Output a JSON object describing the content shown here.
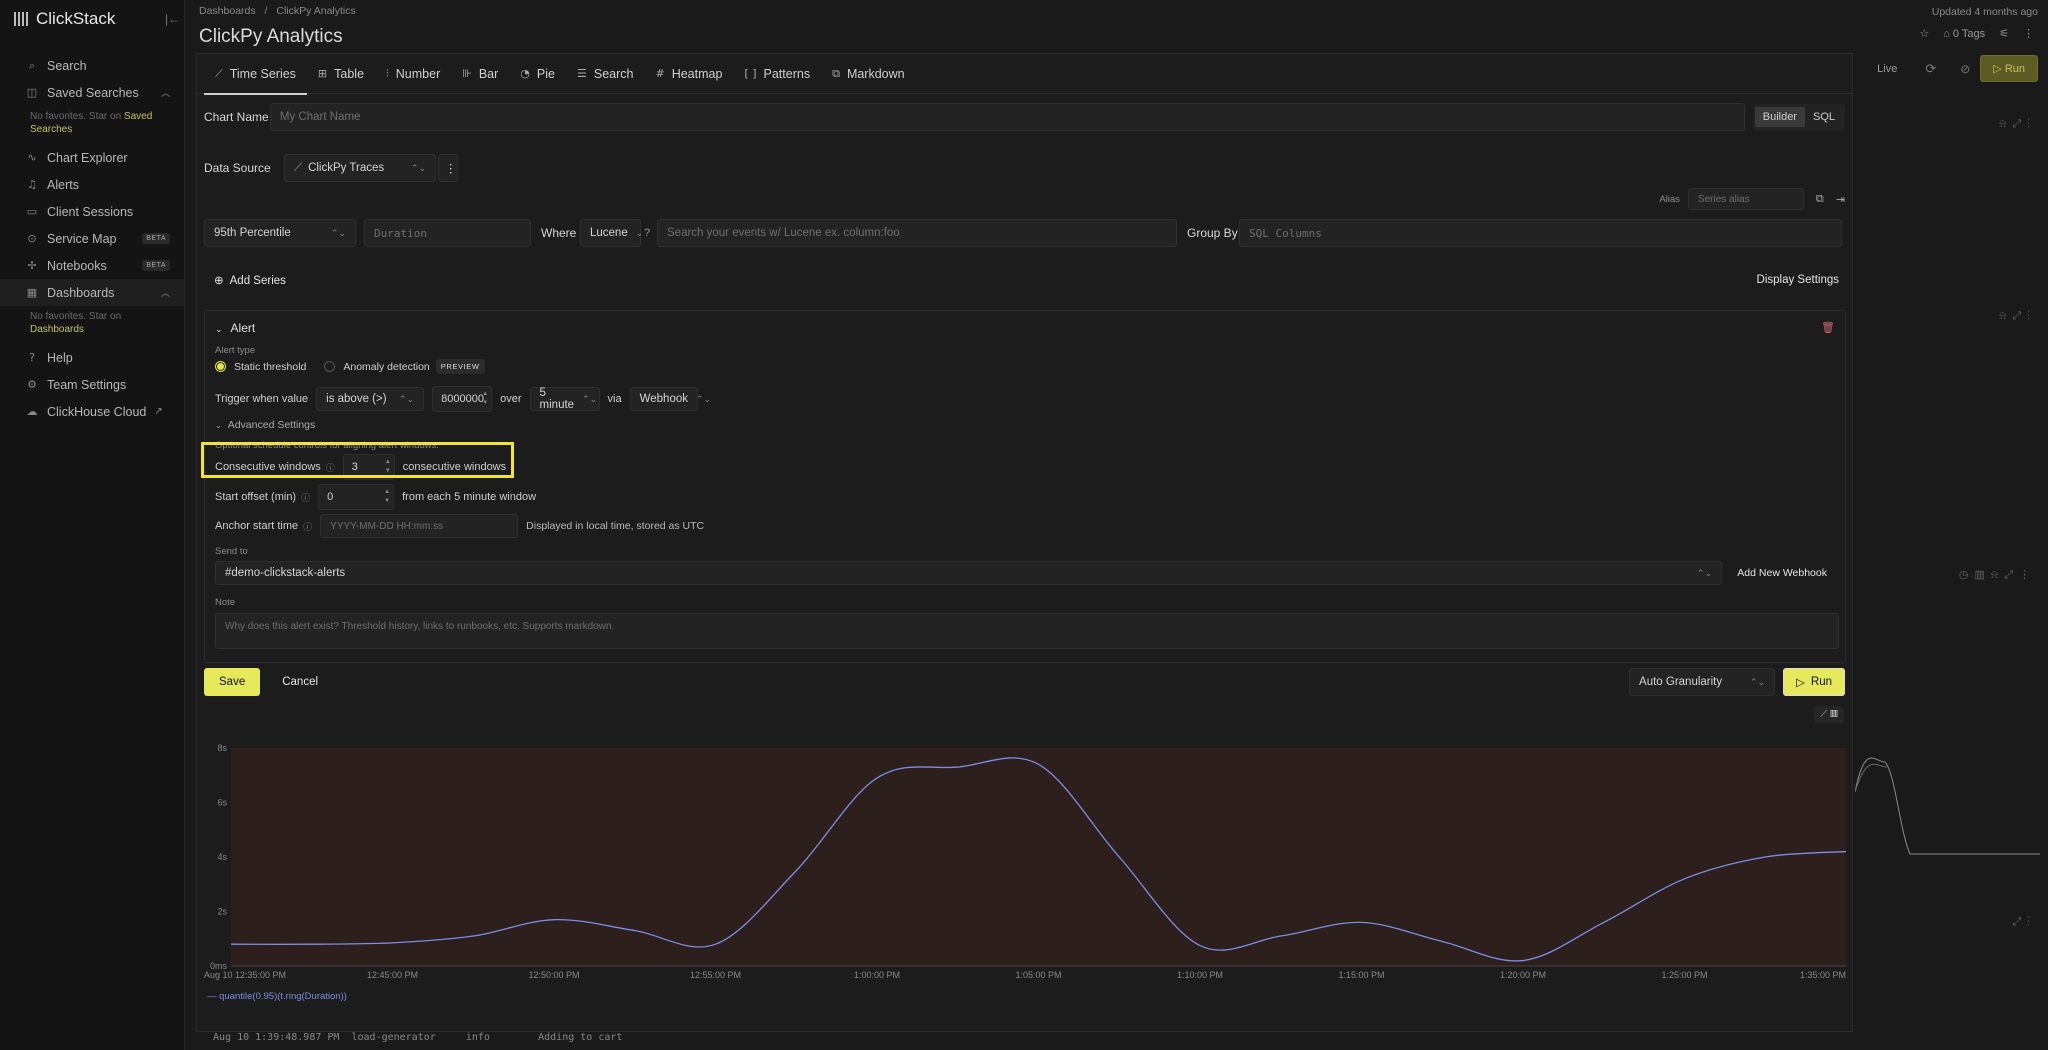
{
  "app": {
    "brand": "ClickStack"
  },
  "sidebar": {
    "items": [
      {
        "label": "Search",
        "icon": "search-icon"
      },
      {
        "label": "Saved Searches",
        "icon": "bookmark-icon"
      },
      {
        "label": "Chart Explorer",
        "icon": "chart-icon"
      },
      {
        "label": "Alerts",
        "icon": "bell-icon"
      },
      {
        "label": "Client Sessions",
        "icon": "browser-icon"
      },
      {
        "label": "Service Map",
        "icon": "map-icon",
        "badge": "BETA"
      },
      {
        "label": "Notebooks",
        "icon": "notebook-icon",
        "badge": "BETA"
      },
      {
        "label": "Dashboards",
        "icon": "dashboard-icon"
      },
      {
        "label": "Help",
        "icon": "help-icon"
      },
      {
        "label": "Team Settings",
        "icon": "gear-icon"
      },
      {
        "label": "ClickHouse Cloud",
        "icon": "cloud-icon"
      }
    ],
    "saved_note_prefix": "No favorites. Star on ",
    "saved_note_link": "Saved Searches",
    "dash_note_prefix": "No favorites. Star on ",
    "dash_note_link": "Dashboards"
  },
  "header": {
    "breadcrumb_root": "Dashboards",
    "breadcrumb_sep": "/",
    "breadcrumb_current": "ClickPy Analytics",
    "title": "ClickPy Analytics",
    "updated": "Updated 4 months ago",
    "tags": "0 Tags",
    "live": "Live",
    "run": "Run"
  },
  "tabs": [
    {
      "label": "Time Series",
      "icon": "line-chart-icon",
      "active": true
    },
    {
      "label": "Table",
      "icon": "table-icon"
    },
    {
      "label": "Number",
      "icon": "number-icon"
    },
    {
      "label": "Bar",
      "icon": "bar-chart-icon"
    },
    {
      "label": "Pie",
      "icon": "pie-chart-icon"
    },
    {
      "label": "Search",
      "icon": "list-icon"
    },
    {
      "label": "Heatmap",
      "icon": "grid-icon"
    },
    {
      "label": "Patterns",
      "icon": "brackets-icon"
    },
    {
      "label": "Markdown",
      "icon": "markdown-icon"
    }
  ],
  "editor": {
    "chart_name_label": "Chart Name",
    "chart_name_placeholder": "My Chart Name",
    "mode_builder": "Builder",
    "mode_sql": "SQL",
    "data_source_label": "Data Source",
    "data_source_value": "ClickPy Traces",
    "alias_label": "Alias",
    "alias_placeholder": "Series alias",
    "aggregation": "95th Percentile",
    "column_placeholder": "Duration",
    "where_label": "Where",
    "query_lang": "Lucene",
    "where_placeholder": "Search your events w/ Lucene ex. column:foo",
    "group_by_label": "Group By",
    "group_by_placeholder": "SQL Columns",
    "add_series": "Add Series",
    "display_settings": "Display Settings"
  },
  "alert": {
    "title": "Alert",
    "type_label": "Alert type",
    "static": "Static threshold",
    "anomaly": "Anomaly detection",
    "preview": "PREVIEW",
    "trigger_label": "Trigger when value",
    "condition": "is above (>)",
    "threshold": "8000000",
    "over": "over",
    "window": "5 minute",
    "via": "via",
    "channel": "Webhook",
    "advanced": "Advanced Settings",
    "advanced_hint": "Optional schedule controls for aligning alert windows.",
    "consecutive_label": "Consecutive windows",
    "consecutive_value": "3",
    "consecutive_suffix": "consecutive windows",
    "offset_label": "Start offset (min)",
    "offset_value": "0",
    "offset_suffix": "from each 5 minute window",
    "anchor_label": "Anchor start time",
    "anchor_placeholder": "YYYY-MM-DD HH:mm:ss",
    "anchor_suffix": "Displayed in local time, stored as UTC",
    "send_to_label": "Send to",
    "send_to_value": "#demo-clickstack-alerts",
    "add_webhook": "Add New Webhook",
    "note_label": "Note",
    "note_placeholder": "Why does this alert exist? Threshold history, links to runbooks, etc. Supports markdown."
  },
  "footer": {
    "save": "Save",
    "cancel": "Cancel",
    "granularity": "Auto Granularity",
    "run": "Run"
  },
  "chart_data": {
    "type": "line",
    "y_ticks": [
      "0ms",
      "2s",
      "4s",
      "6s",
      "8s"
    ],
    "ylim": [
      0,
      8
    ],
    "x_ticks": [
      "Aug 10 12:35:00 PM",
      "12:45:00 PM",
      "12:50:00 PM",
      "12:55:00 PM",
      "1:00:00 PM",
      "1:05:00 PM",
      "1:10:00 PM",
      "1:15:00 PM",
      "1:20:00 PM",
      "1:25:00 PM",
      "1:35:00 PM"
    ],
    "x": [
      0,
      3,
      6,
      9,
      12,
      15,
      18,
      21,
      24,
      27,
      30,
      33,
      36,
      39,
      42,
      45,
      48,
      51,
      54,
      57,
      60
    ],
    "values": [
      0.8,
      0.8,
      0.85,
      1.1,
      1.7,
      1.3,
      0.8,
      3.5,
      6.9,
      7.3,
      7.4,
      4.0,
      0.75,
      1.1,
      1.6,
      0.9,
      0.2,
      1.6,
      3.2,
      4.0,
      4.2
    ],
    "series": [
      {
        "name": "quantile(0.95)(t.ring(Duration))",
        "color": "#7b8fe6"
      }
    ],
    "threshold_fill": "#2c1f1c"
  },
  "background": {
    "log_line": "Aug 10 1:39:48.987 PM  load-generator     info        Adding to cart"
  }
}
